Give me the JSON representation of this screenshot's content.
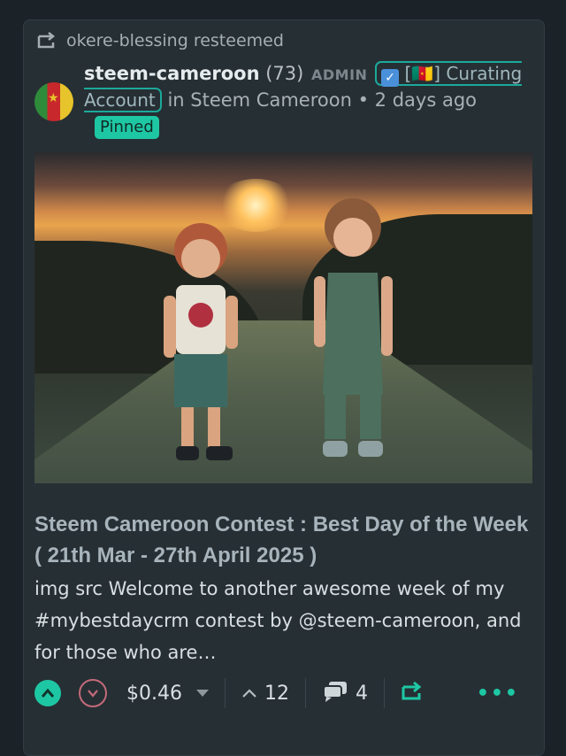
{
  "resteem": {
    "label": "okere-blessing resteemed"
  },
  "post": {
    "author": "steem-cameroon",
    "reputation": "(73)",
    "role": "ADMIN",
    "badge_label": "[🇨🇲] Curating Account",
    "community": "in Steem Cameroon",
    "time": "2 days ago",
    "pinned": "Pinned",
    "title": "Steem Cameroon Contest : Best Day of the Week ( 21th Mar - 27th April 2025 )",
    "summary": "img src Welcome to another awesome week of my #mybestdaycrm contest by @steem-cameroon, and for those who are…"
  },
  "actions": {
    "payout": "$0.46",
    "votes": "12",
    "comments": "4"
  },
  "colors": {
    "accent": "#1ec7a4",
    "card": "#262f34",
    "background": "#1b2328",
    "downvote": "#c46a7a"
  },
  "icons": [
    "resteem-icon",
    "upvote-icon",
    "downvote-icon",
    "caret-down-icon",
    "votes-chevron-icon",
    "comments-icon",
    "reblog-icon",
    "more-icon"
  ]
}
